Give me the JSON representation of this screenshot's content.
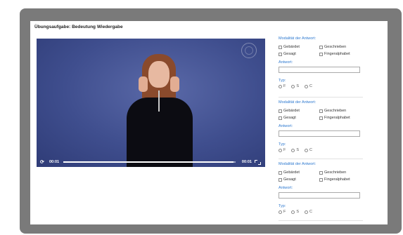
{
  "title": "Übungsaufgabe: Bedeutung Wiedergabe",
  "video": {
    "current_time": "00:01",
    "duration": "00:01",
    "progress": 0.99
  },
  "answer_blocks": [
    {
      "modality_label": "Modalität der Antwort:",
      "options": [
        "Gebärdet",
        "Geschrieben",
        "Gesagt",
        "Fingeralphabet"
      ],
      "answer_label": "Antwort:",
      "answer_value": "",
      "type_label": "Typ:",
      "type_options": [
        "F",
        "S",
        "C"
      ]
    },
    {
      "modality_label": "Modalität der Antwort:",
      "options": [
        "Gebärdet",
        "Geschrieben",
        "Gesagt",
        "Fingeralphabet"
      ],
      "answer_label": "Antwort:",
      "answer_value": "",
      "type_label": "Typ:",
      "type_options": [
        "F",
        "S",
        "C"
      ]
    },
    {
      "modality_label": "Modalität der Antwort:",
      "options": [
        "Gebärdet",
        "Geschrieben",
        "Gesagt",
        "Fingeralphabet"
      ],
      "answer_label": "Antwort:",
      "answer_value": "",
      "type_label": "Typ:",
      "type_options": [
        "F",
        "S",
        "C"
      ]
    }
  ],
  "colors": {
    "label_blue": "#2f7ad0",
    "frame_gray": "#7a7a7a",
    "video_bg": "#3f4e8e"
  }
}
